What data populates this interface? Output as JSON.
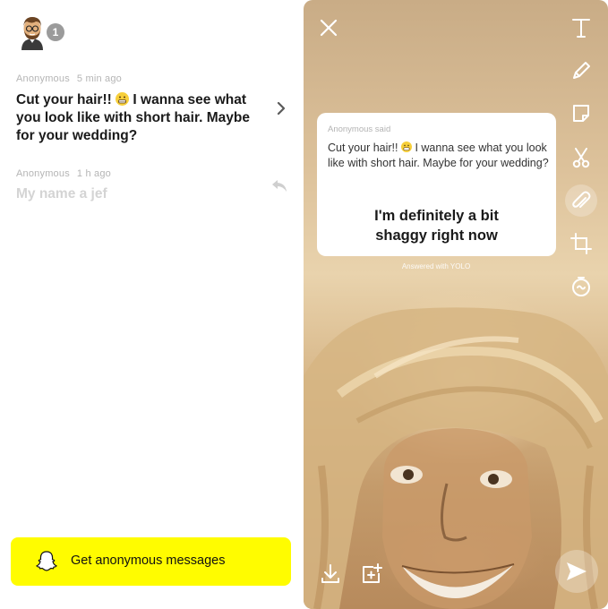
{
  "inbox": {
    "badge_count": "1",
    "messages": [
      {
        "sender": "Anonymous",
        "time": "5 min ago",
        "text_before_emoji": "Cut your hair!! ",
        "text_after_emoji": " I wanna see what you look like with short hair. Maybe for your wedding?",
        "emoji": "grimacing-face-emoji"
      },
      {
        "sender": "Anonymous",
        "time": "1 h ago",
        "text": "My name a jef"
      }
    ],
    "cta_label": "Get anonymous messages"
  },
  "story": {
    "card": {
      "meta": "Anonymous said",
      "question_before_emoji": "Cut your hair!! ",
      "question_after_emoji": " I wanna see what you look like with short hair. Maybe for your wedding?",
      "answer": "I'm definitely a bit shaggy right now"
    },
    "answered_with": "Answered with YOLO",
    "tools": [
      "text-tool-icon",
      "pencil-icon",
      "sticker-icon",
      "scissors-icon",
      "paperclip-icon",
      "crop-icon",
      "timer-icon"
    ],
    "top_left": "close-icon",
    "bottom_left": [
      "download-icon",
      "add-to-story-icon"
    ],
    "send": "send-icon"
  },
  "colors": {
    "cta_yellow": "#fffc00",
    "badge_gray": "#9b9b9b",
    "muted_text": "#b5b5b5"
  }
}
